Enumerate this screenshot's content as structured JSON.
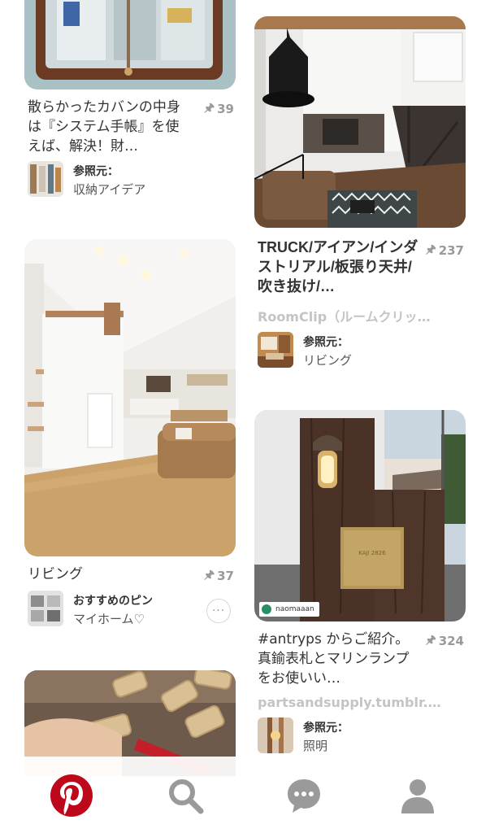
{
  "pins": {
    "binder": {
      "title": "散らかったカバンの中身は『システム手帳』を使えば、解決！財…",
      "saves": "39",
      "source_label": "参照元：",
      "source_board": "収納アイデア"
    },
    "truck": {
      "title": "TRUCK/アイアン/インダストリアル/板張り天井/吹き抜け/…",
      "saves": "237",
      "domain": "RoomClip（ルームクリッ…",
      "source_label": "参照元：",
      "source_board": "リビング"
    },
    "living": {
      "title": "リビング",
      "saves": "37",
      "source_label": "おすすめのピン",
      "source_board": "マイホーム♡",
      "more_label": "···"
    },
    "antryps": {
      "image_tag": "naomaaan",
      "plate_text": "KAJI 2826",
      "title": "#antryps からご紹介。 真鍮表札とマリンランプをお使いい…",
      "saves": "324",
      "domain": "partsandsupply.tumblr.…",
      "source_label": "参照元：",
      "source_board": "照明"
    }
  },
  "tabbar": {
    "home": "pinterest-logo-icon",
    "search": "search-icon",
    "messages": "chat-bubble-icon",
    "profile": "profile-icon"
  },
  "colors": {
    "brand": "#bd081c",
    "icon_gray": "#9a9a9a",
    "domain_gray": "#c4c4c4"
  }
}
